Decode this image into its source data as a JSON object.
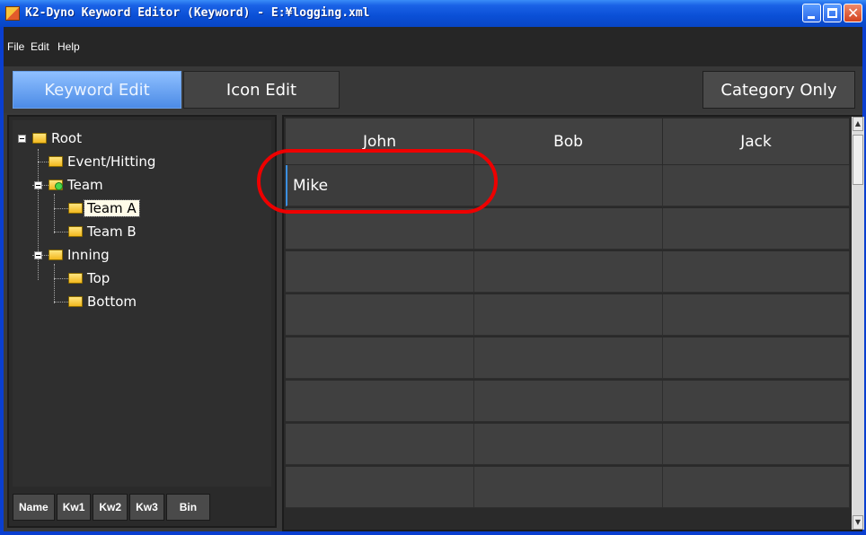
{
  "window": {
    "title": "K2-Dyno Keyword Editor (Keyword) - E:¥logging.xml"
  },
  "menu": [
    {
      "label": "File"
    },
    {
      "label": "Edit"
    },
    {
      "label": "Help"
    }
  ],
  "toolbar": {
    "keyword_edit_label": "Keyword Edit",
    "icon_edit_label": "Icon Edit",
    "category_only_label": "Category Only"
  },
  "tree": {
    "nodes": [
      {
        "label": "Root"
      },
      {
        "label": "Event/Hitting"
      },
      {
        "label": "Team"
      },
      {
        "label": "Team A"
      },
      {
        "label": "Team B"
      },
      {
        "label": "Inning"
      },
      {
        "label": "Top"
      },
      {
        "label": "Bottom"
      }
    ]
  },
  "bottom_tabs": [
    {
      "label": "Name"
    },
    {
      "label": "Kw1"
    },
    {
      "label": "Kw2"
    },
    {
      "label": "Kw3"
    },
    {
      "label": "Bin"
    }
  ],
  "grid": {
    "columns": [
      "John",
      "Bob",
      "Jack"
    ],
    "rows": [
      [
        "Mike",
        "",
        ""
      ],
      [
        "",
        "",
        ""
      ],
      [
        "",
        "",
        ""
      ],
      [
        "",
        "",
        ""
      ],
      [
        "",
        "",
        ""
      ],
      [
        "",
        "",
        ""
      ],
      [
        "",
        "",
        ""
      ],
      [
        "",
        "",
        ""
      ]
    ]
  },
  "colors": {
    "highlight_ring": "#e00000",
    "active_tab": "#6aa3f0"
  }
}
